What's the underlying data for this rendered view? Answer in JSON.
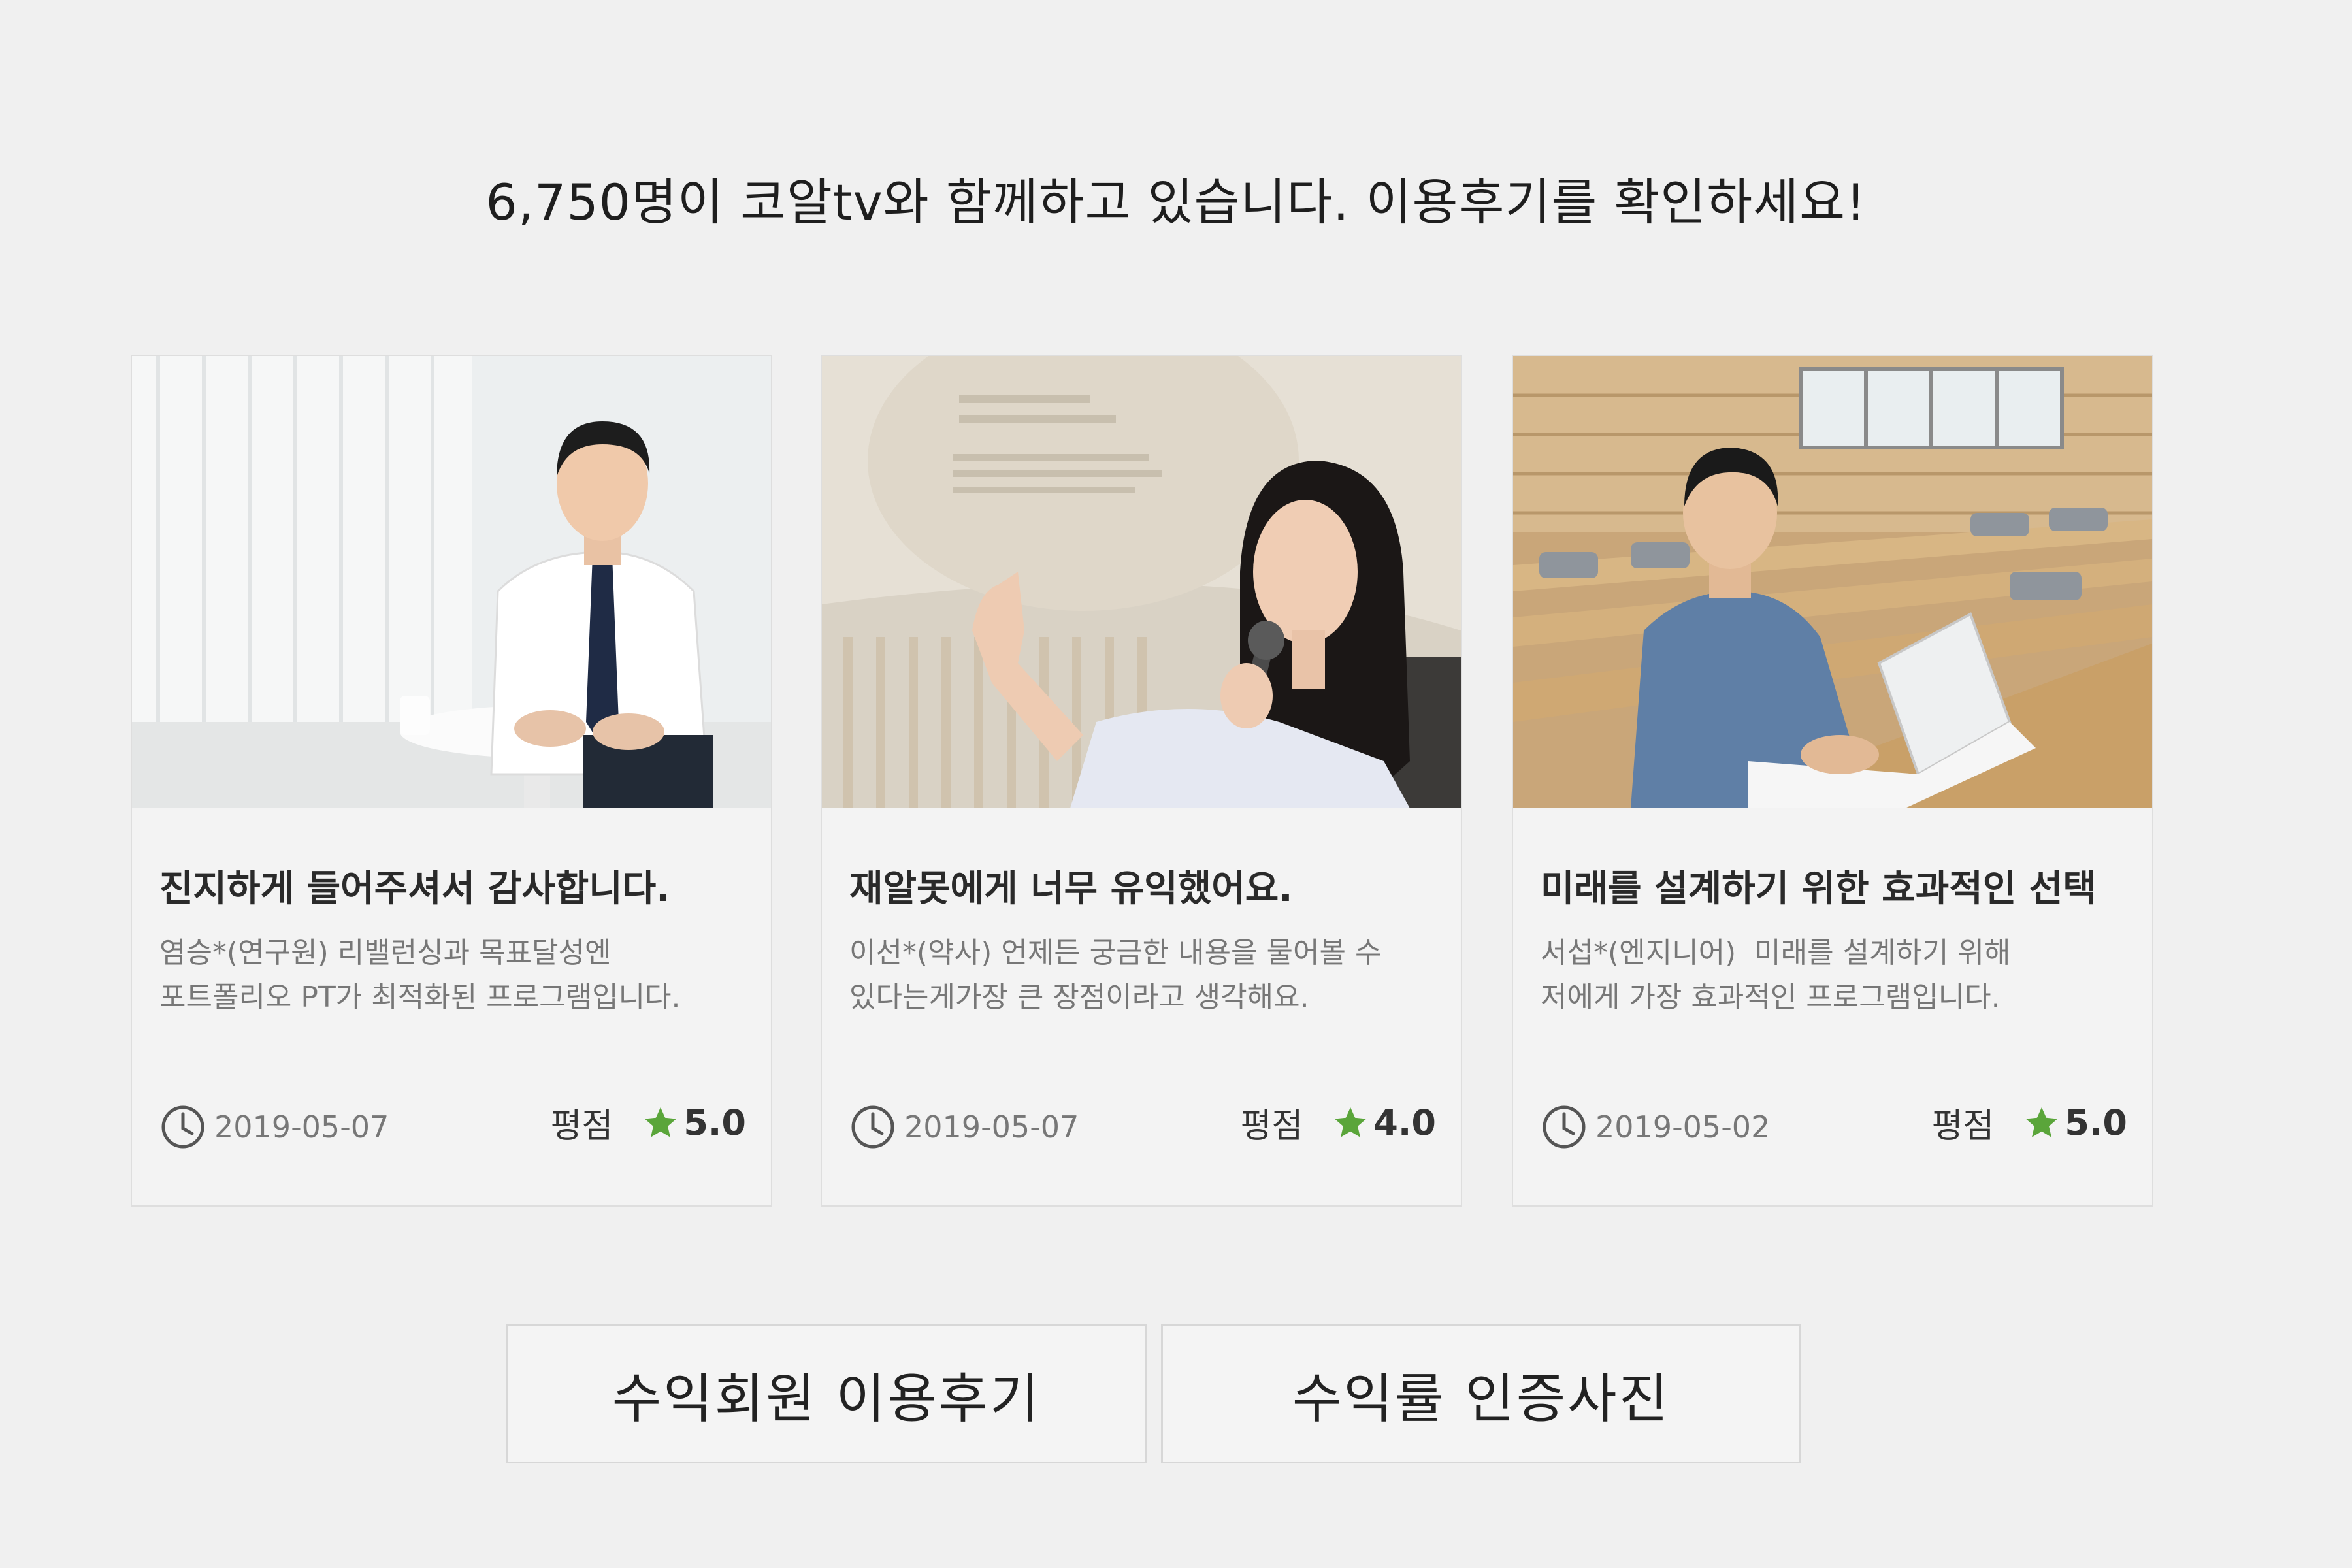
{
  "headline": "6,750명이 코알tv와 함께하고 있습니다. 이용후기를 확인하세요!",
  "rating_label": "평점",
  "colors": {
    "background": "#f0f0f0",
    "card": "#f3f3f3",
    "star": "#5aa53a",
    "text_muted": "#777777"
  },
  "icons": {
    "clock": "clock-icon",
    "star": "star-icon"
  },
  "reviews": [
    {
      "title": "진지하게 들어주셔서 감사합니다.",
      "desc_line1": "염승*(연구원) 리밸런싱과 목표달성엔",
      "desc_line2": "포트폴리오 PT가 최적화된 프로그램입니다.",
      "date": "2019-05-07",
      "rating": "5.0"
    },
    {
      "title": "재알못에게 너무 유익했어요.",
      "desc_line1": "이선*(약사) 언제든 궁금한 내용을 물어볼 수",
      "desc_line2": "있다는게가장 큰 장점이라고 생각해요.",
      "date": "2019-05-07",
      "rating": "4.0"
    },
    {
      "title": "미래를 설계하기 위한 효과적인 선택",
      "desc_line1": "서섭*(엔지니어)  미래를 설계하기 위해",
      "desc_line2": "저에게 가장 효과적인 프로그램입니다.",
      "date": "2019-05-02",
      "rating": "5.0"
    }
  ],
  "buttons": {
    "member_reviews": "수익회원 이용후기",
    "proof_photos": "수익률 인증사진"
  }
}
